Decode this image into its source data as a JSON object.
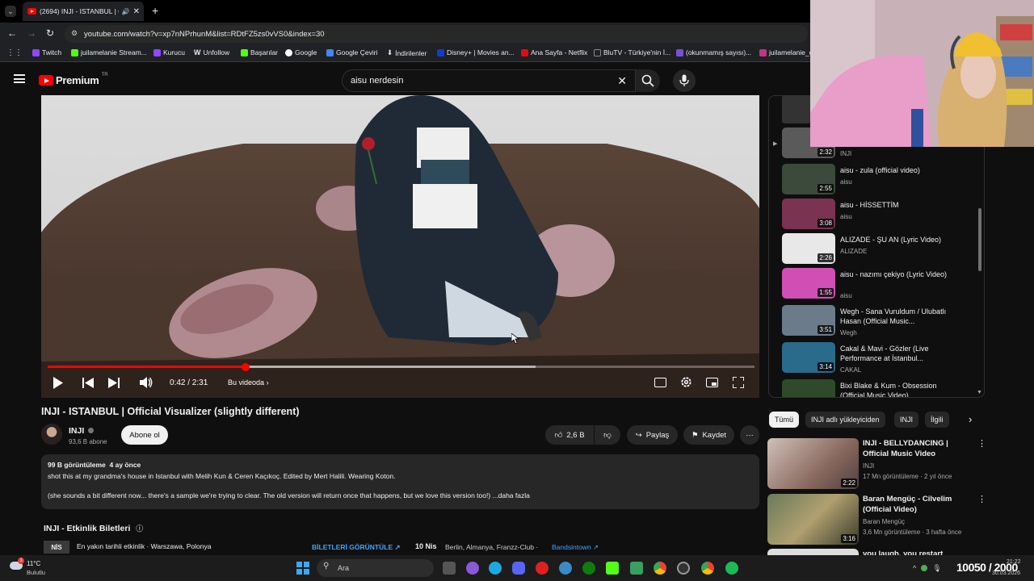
{
  "browser": {
    "tab_title": "(2694) INJI - ISTANBUL | Of",
    "url": "youtube.com/watch?v=xp7nNPrhunM&list=RDtFZ5zs0vVS0&index=30",
    "bookmarks": [
      "Twitch",
      "juilamelanie Stream...",
      "Kurucu",
      "Unfollow",
      "Başarılar",
      "Google",
      "Google Çeviri",
      "İndirilenler",
      "Disney+ | Movies an...",
      "Ana Sayfa - Netflix",
      "BluTV - Türkiye'nin İ...",
      "(okunmamış sayısı)...",
      "juilamelanie_c"
    ]
  },
  "youtube": {
    "logo_text": "Premium",
    "logo_sup": "TR",
    "search_value": "aisu nerdesin"
  },
  "player": {
    "time": "0:42 / 2:31",
    "chapter": "Bu videoda",
    "progress_fraction": 0.28,
    "buffer_fraction": 0.69
  },
  "video": {
    "title": "INJI - ISTANBUL | Official Visualizer (slightly different)",
    "channel": "INJI",
    "subscribers": "93,6 B abone",
    "subscribe_label": "Abone ol",
    "likes": "2,6 B",
    "share_label": "Paylaş",
    "save_label": "Kaydet",
    "views": "99 B görüntüleme",
    "age": "4 ay önce",
    "desc_line1": "shot this at my grandma's house in Istanbul with Melih Kun & Ceren Kaçıkoç. Edited by Mert Halili. Wearing Koton.",
    "desc_line2": "(she sounds a bit different now... there's a sample we're trying to clear. The old version will return once that happens, but we love this version too!) ...daha fazla"
  },
  "tickets": {
    "heading": "INJI - Etkinlik Biletleri",
    "month": "NİS",
    "nearest": "En yakın tarihli etkinlik · Warszawa, Polonya",
    "view_tickets": "BİLETLERİ GÖRÜNTÜLE",
    "date": "10 Nis",
    "venue": "Berlin, Almanya, Franzz-Club ·",
    "seller": "Bandsintown"
  },
  "playlist": [
    {
      "title": "",
      "channel": "INJI",
      "duration": "2:32",
      "color": "#5a5a5a"
    },
    {
      "title": "aisu - zula (official video)",
      "channel": "aisu",
      "duration": "2:55",
      "color": "#3b4a3a"
    },
    {
      "title": "aisu - HİSSETTİM",
      "channel": "aisu",
      "duration": "3:08",
      "color": "#7a3350"
    },
    {
      "title": "ALIZADE - ŞU AN (Lyric Video)",
      "channel": "ALIZADE",
      "duration": "2:26",
      "color": "#e8e8e8"
    },
    {
      "title": "aisu - nazımı çekiyo (Lyric Video)",
      "channel": "aisu",
      "duration": "1:55",
      "color": "#d14fb5"
    },
    {
      "title": "Wegh - Sana Vuruldum / Ulubatlı Hasan (Official Music...",
      "channel": "Wegh",
      "duration": "3:51",
      "color": "#6b7b8a"
    },
    {
      "title": "Cakal & Mavi - Gözler (Live Performance at İstanbul...",
      "channel": "CAKAL",
      "duration": "3:14",
      "color": "#2a6a8a"
    },
    {
      "title": "Bixi Blake & Kum - Obsession (Official Music Video)",
      "channel": "",
      "duration": "",
      "color": "#2f4a2a"
    }
  ],
  "chips": [
    "Tümü",
    "INJI adlı yükleyiciden",
    "INJI",
    "İlgili"
  ],
  "related": [
    {
      "title": "INJI - BELLYDANCING | Official Music Video",
      "channel": "INJI",
      "meta": "17 Mn görüntüleme · 2 yıl önce",
      "duration": "2:22"
    },
    {
      "title": "Baran Mengüç - Cilvelim (Official Video)",
      "channel": "Baran Mengüç",
      "meta": "3,6 Mn görüntüleme · 3 hafta önce",
      "duration": "3:16"
    },
    {
      "title": "you laugh, you restart",
      "channel": "",
      "meta": "",
      "duration": ""
    }
  ],
  "taskbar": {
    "weather_temp": "11°C",
    "weather_desc": "Bulutlu",
    "search_placeholder": "Ara",
    "clock": "10050 / 2000",
    "date": "30.03.2026",
    "time_small": "21:22"
  }
}
